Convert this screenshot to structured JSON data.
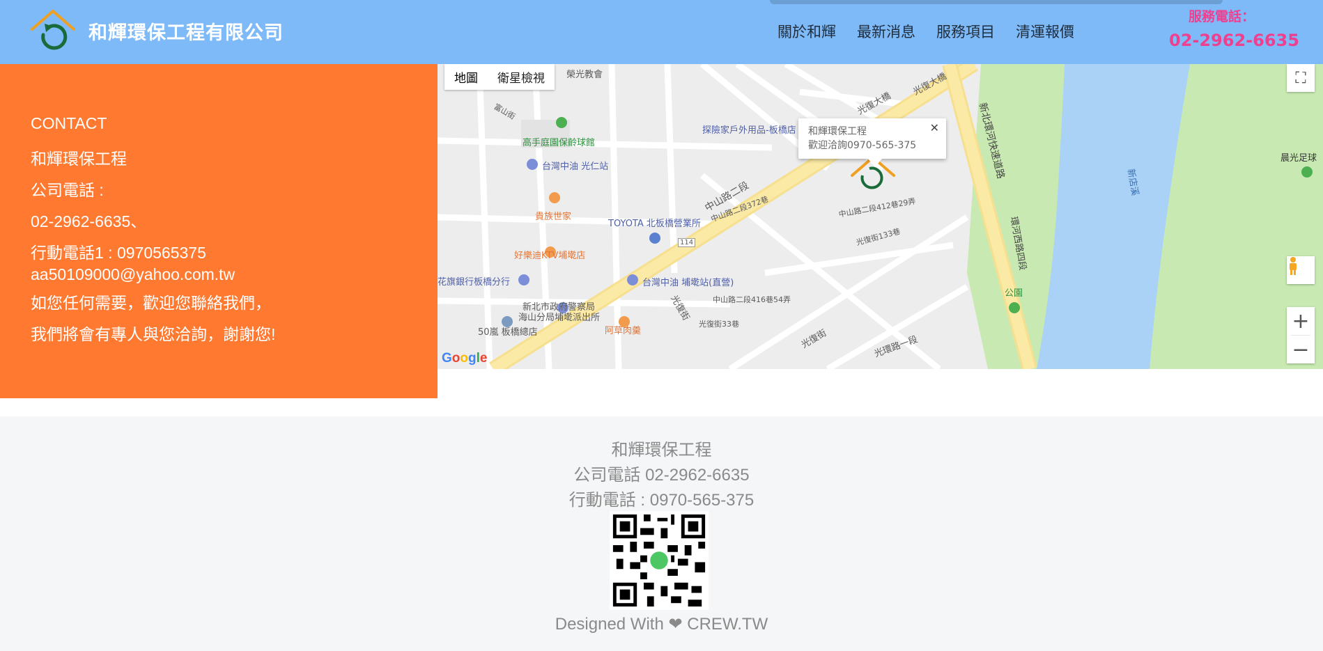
{
  "header": {
    "brand": "和輝環保工程有限公司",
    "nav": [
      "關於和輝",
      "最新消息",
      "服務項目",
      "清運報價"
    ],
    "hotline_label": "服務電話：",
    "hotline_number": "02-2962-6635"
  },
  "contact": {
    "heading": "CONTACT",
    "company": "和輝環保工程",
    "phone_label": "公司電話 :",
    "phone": "02-2962-6635、",
    "mobile": "行動電話1 : 0970565375",
    "email": "aa50109000@yahoo.com.tw",
    "message1": "如您任何需要，歡迎您聯絡我們，",
    "message2": "我們將會有專人與您洽詢，謝謝您!"
  },
  "map": {
    "type_map": "地圖",
    "type_satellite": "衛星檢視",
    "infowindow_title": "和輝環保工程",
    "infowindow_text": "歡迎洽詢0970-565-375",
    "google": "Google",
    "labels": {
      "church": "榮光教會",
      "bowling": "高手庭園保齡球館",
      "gas1": "台灣中油 光仁站",
      "outdoor": "探險家戶外用品-板橋店",
      "bridge": "光復大橋",
      "bridge2": "光復大橋",
      "expressway": "新北環河快速道路",
      "zhongshan": "中山路二段",
      "toyota": "TOYOTA 北板橋營業所",
      "noble": "貴族世家",
      "ktv": "好樂迪KTV埔墘店",
      "bank": "花旗銀行板橋分行",
      "gas2": "台灣中油 埔墘站(直營)",
      "police1": "新北市政府警察局",
      "police2": "海山分局埔墘派出所",
      "fiftylan": "50嵐 板橋總店",
      "acao": "阿草肉羹",
      "guangfu": "光復街",
      "guangfu2": "光復街",
      "guanghuan": "光環路一段",
      "huanhe": "環河西路四段",
      "park": "公園",
      "chenguang": "晨光足球",
      "river": "新店溪",
      "road114": "114",
      "fushan": "富山街",
      "lane1": "中山路二段412巷29弄",
      "lane2": "光復街133巷",
      "lane3": "中山路二段416巷54弄",
      "lane4": "光復街33巷",
      "lane5": "中山路二段372巷"
    }
  },
  "footer": {
    "company": "和輝環保工程",
    "phone": "公司電話 02-2962-6635",
    "mobile": "行動電話 : 0970-565-375",
    "credit_prefix": "Designed With",
    "credit_suffix": "CREW.TW"
  },
  "colors": {
    "header_bg": "#7fbaf8",
    "contact_bg": "#ff7a30",
    "hotline": "#ef3f8f"
  }
}
